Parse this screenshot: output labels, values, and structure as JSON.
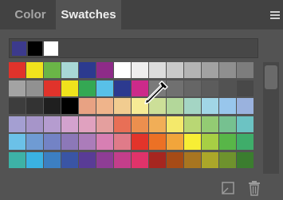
{
  "tabs": [
    {
      "label": "Color",
      "active": false
    },
    {
      "label": "Swatches",
      "active": true
    }
  ],
  "icons": {
    "panel_menu": "panel-menu-icon",
    "new_swatch": "new-swatch-icon",
    "delete_swatch": "trash-icon",
    "cursor": "eyedropper-icon"
  },
  "recent_swatches": [
    "#3c3a8c",
    "#000000",
    "#ffffff"
  ],
  "swatch_rows": [
    [
      "#e0332b",
      "#f0e21c",
      "#6ab547",
      "#a8d8d6",
      "#2c3a8f",
      "#8e2b88",
      "#ffffff",
      "#eeeeee",
      "#dcdcdc",
      "#c9c9c9",
      "#b4b4b4",
      "#a2a2a2",
      "#8f8f8f",
      "#7d7d7d"
    ],
    [
      "#a3a3a3",
      "#919191",
      "#e0332b",
      "#f0e21c",
      "#34a853",
      "#58c0e8",
      "#2c3a8f",
      "#cc2a8a",
      "#7a7a7a",
      "#707070",
      "#666666",
      "#5c5c5c",
      "#525252",
      "#484848"
    ],
    [
      "#3d3d3d",
      "#333333",
      "#1f1f1f",
      "#000000",
      "#e8a283",
      "#efb48b",
      "#f1cc90",
      "#f6eb95",
      "#ccdf98",
      "#b3d79a",
      "#a4d5c4",
      "#a1d6e6",
      "#98c6ec",
      "#9ab2de"
    ],
    [
      "#a49fd2",
      "#a695c9",
      "#b59ccf",
      "#d3a2ce",
      "#e0a1bf",
      "#e49f9e",
      "#e86f56",
      "#ec8f4e",
      "#f1ae57",
      "#f4e96b",
      "#b9d774",
      "#93cb73",
      "#76c190",
      "#6cc3c3"
    ],
    [
      "#6bc1e8",
      "#6f9bd3",
      "#7383c5",
      "#8c78b8",
      "#ab7cba",
      "#d77fb3",
      "#e07b89",
      "#e2342a",
      "#ec7125",
      "#f1a53b",
      "#f7ee35",
      "#a7cf44",
      "#58b648",
      "#3fad6a"
    ],
    [
      "#3db2a6",
      "#3ab2e2",
      "#3c7fc2",
      "#3a55a5",
      "#593c96",
      "#8e3d95",
      "#c33e8b",
      "#e0336a",
      "#a62620",
      "#a64b16",
      "#a87520",
      "#aba729",
      "#6e922d",
      "#3b7d2f"
    ]
  ]
}
